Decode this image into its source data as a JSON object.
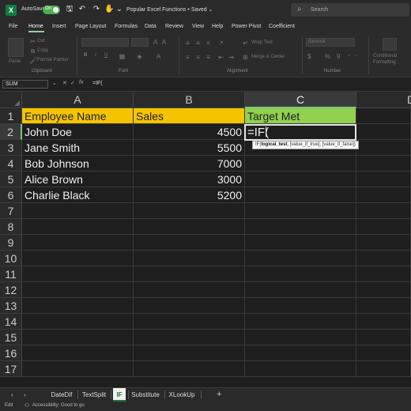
{
  "titlebar": {
    "app_logo": "X",
    "autosave_label": "AutoSave",
    "autosave_state": "On",
    "document_title": "Popular Excel Functions • Saved ⌄",
    "search_placeholder": "Search",
    "icons": [
      "save-icon",
      "undo-icon",
      "redo-icon",
      "touch-mode-icon",
      "more-icon"
    ]
  },
  "menu": {
    "items": [
      "File",
      "Home",
      "Insert",
      "Page Layout",
      "Formulas",
      "Data",
      "Review",
      "View",
      "Help",
      "Power Pivot",
      "Coefficient"
    ],
    "active": "Home"
  },
  "ribbon": {
    "clipboard": {
      "paste": "Paste",
      "cut": "Cut",
      "copy": "Copy",
      "format_painter": "Format Painter",
      "label": "Clipboard"
    },
    "font": {
      "label": "Font",
      "bold": "B",
      "italic": "I",
      "underline": "U"
    },
    "alignment": {
      "wrap_text": "Wrap Text",
      "merge_center": "Merge & Center",
      "label": "Alignment"
    },
    "number": {
      "format": "General",
      "label": "Number",
      "currency": "$",
      "percent": "%",
      "comma": "9"
    },
    "styles": {
      "conditional_formatting": "Conditional Formatting"
    }
  },
  "formula_bar": {
    "name_box": "SUM",
    "cancel_icon": "✕",
    "enter_icon": "✓",
    "fx": "fx",
    "content": "=IF("
  },
  "sheet": {
    "columns": [
      "A",
      "B",
      "C",
      "D"
    ],
    "rows": [
      "1",
      "2",
      "3",
      "4",
      "5",
      "6",
      "7",
      "8",
      "9",
      "10",
      "11",
      "12",
      "13",
      "14",
      "15",
      "16",
      "17"
    ],
    "headers": {
      "a": "Employee Name",
      "b": "Sales",
      "c": "Target Met"
    },
    "data": [
      {
        "name": "John Doe",
        "sales": "4500"
      },
      {
        "name": "Jane Smith",
        "sales": "5500"
      },
      {
        "name": "Bob Johnson",
        "sales": "7000"
      },
      {
        "name": "Alice Brown",
        "sales": "3000"
      },
      {
        "name": "Charlie Black",
        "sales": "5200"
      }
    ],
    "active_cell": "C2",
    "editing_text": "=IF(",
    "tooltip": {
      "func": "IF(",
      "arg1": "logical_test",
      "rest": ", [value_if_true], [value_if_false])"
    },
    "colors": {
      "header_yellow": "#f5c400",
      "header_green": "#92d050",
      "accent": "#107c41"
    }
  },
  "tabs": {
    "items": [
      "DateDif",
      "TextSplit",
      "IF",
      "Substitute",
      "XLookUp"
    ],
    "active": "IF",
    "nav_prev": "‹",
    "nav_next": "›",
    "add": "+"
  },
  "status": {
    "mode": "Edit",
    "accessibility": "Accessibility: Good to go"
  }
}
